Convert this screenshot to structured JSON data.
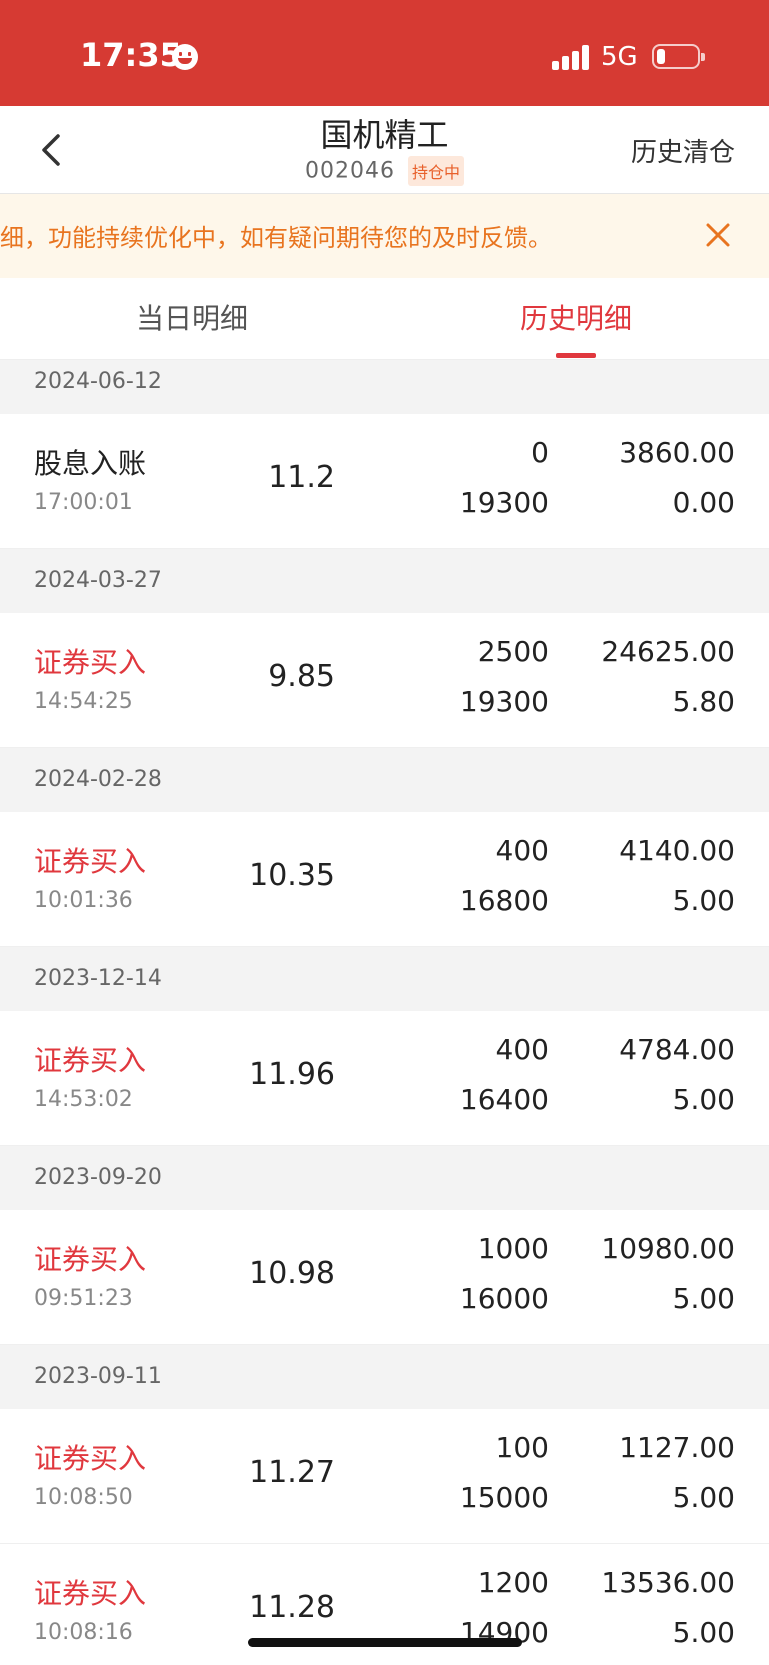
{
  "status_bar": {
    "time": "17:35",
    "network": "5G"
  },
  "nav": {
    "title": "国机精工",
    "code": "002046",
    "badge": "持仓中",
    "right_action": "历史清仓"
  },
  "notice": {
    "text": "细，功能持续优化中，如有疑问期待您的及时反馈。"
  },
  "tabs": [
    {
      "label": "当日明细",
      "active": false
    },
    {
      "label": "历史明细",
      "active": true
    }
  ],
  "groups": [
    {
      "date": "2024-06-12",
      "rows": [
        {
          "type": "股息入账",
          "time": "17:00:01",
          "price": "11.2",
          "qty": "0",
          "balance": "19300",
          "amount": "3860.00",
          "fee": "0.00",
          "is_buy": false
        }
      ]
    },
    {
      "date": "2024-03-27",
      "rows": [
        {
          "type": "证券买入",
          "time": "14:54:25",
          "price": "9.85",
          "qty": "2500",
          "balance": "19300",
          "amount": "24625.00",
          "fee": "5.80",
          "is_buy": true
        }
      ]
    },
    {
      "date": "2024-02-28",
      "rows": [
        {
          "type": "证券买入",
          "time": "10:01:36",
          "price": "10.35",
          "qty": "400",
          "balance": "16800",
          "amount": "4140.00",
          "fee": "5.00",
          "is_buy": true
        }
      ]
    },
    {
      "date": "2023-12-14",
      "rows": [
        {
          "type": "证券买入",
          "time": "14:53:02",
          "price": "11.96",
          "qty": "400",
          "balance": "16400",
          "amount": "4784.00",
          "fee": "5.00",
          "is_buy": true
        }
      ]
    },
    {
      "date": "2023-09-20",
      "rows": [
        {
          "type": "证券买入",
          "time": "09:51:23",
          "price": "10.98",
          "qty": "1000",
          "balance": "16000",
          "amount": "10980.00",
          "fee": "5.00",
          "is_buy": true
        }
      ]
    },
    {
      "date": "2023-09-11",
      "rows": [
        {
          "type": "证券买入",
          "time": "10:08:50",
          "price": "11.27",
          "qty": "100",
          "balance": "15000",
          "amount": "1127.00",
          "fee": "5.00",
          "is_buy": true
        },
        {
          "type": "证券买入",
          "time": "10:08:16",
          "price": "11.28",
          "qty": "1200",
          "balance": "14900",
          "amount": "13536.00",
          "fee": "5.00",
          "is_buy": true
        }
      ]
    }
  ],
  "colors": {
    "brand_red": "#d63a33",
    "buy_red": "#e0383e",
    "notice_orange": "#e8741f"
  }
}
